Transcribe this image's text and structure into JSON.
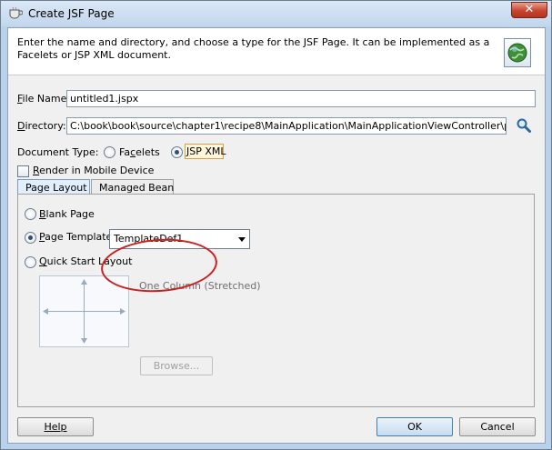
{
  "window": {
    "title": "Create JSF Page",
    "close_glyph": "✕"
  },
  "header": {
    "description": "Enter the name and directory, and choose a type for the JSF Page. It can be implemented as a Facelets or JSP XML document.",
    "icon": "globe-icon"
  },
  "form": {
    "file_name_label_mnemonic": "F",
    "file_name_label_rest": "ile Name:",
    "file_name_value": "untitled1.jspx",
    "directory_label_mnemonic": "D",
    "directory_label_rest": "irectory:",
    "directory_value": "C:\\book\\book\\source\\chapter1\\recipe8\\MainApplication\\MainApplicationViewController\\public_html",
    "browse_icon": "search-icon",
    "document_type_label": "Document Type:",
    "doc_type_facelets_pre": "Fa",
    "doc_type_facelets_mnemonic": "c",
    "doc_type_facelets_post": "elets",
    "doc_type_jspxml_mnemonic": "J",
    "doc_type_jspxml_rest": "SP XML",
    "doc_type_selected": "JSP XML",
    "render_mobile_mnemonic": "R",
    "render_mobile_rest": "ender in Mobile Device",
    "render_mobile_checked": false
  },
  "tabs": [
    {
      "label": "Page Layout",
      "active": true
    },
    {
      "label": "Managed Bean",
      "active": false
    }
  ],
  "page_layout": {
    "blank_page_mnemonic": "B",
    "blank_page_rest": "lank Page",
    "page_template_mnemonic": "P",
    "page_template_rest": "age Template",
    "quick_start_mnemonic": "Q",
    "quick_start_rest": "uick Start Layout",
    "selected_option": "Page Template",
    "template_value": "TemplateDef1",
    "layout_name": "One Column (Stretched)",
    "browse_button_label": "Browse..."
  },
  "footer": {
    "help_label": "Help",
    "ok_label": "OK",
    "cancel_label": "Cancel"
  },
  "colors": {
    "annotation_ellipse": "#cc2020",
    "window_frame": "#b9d1ea"
  }
}
